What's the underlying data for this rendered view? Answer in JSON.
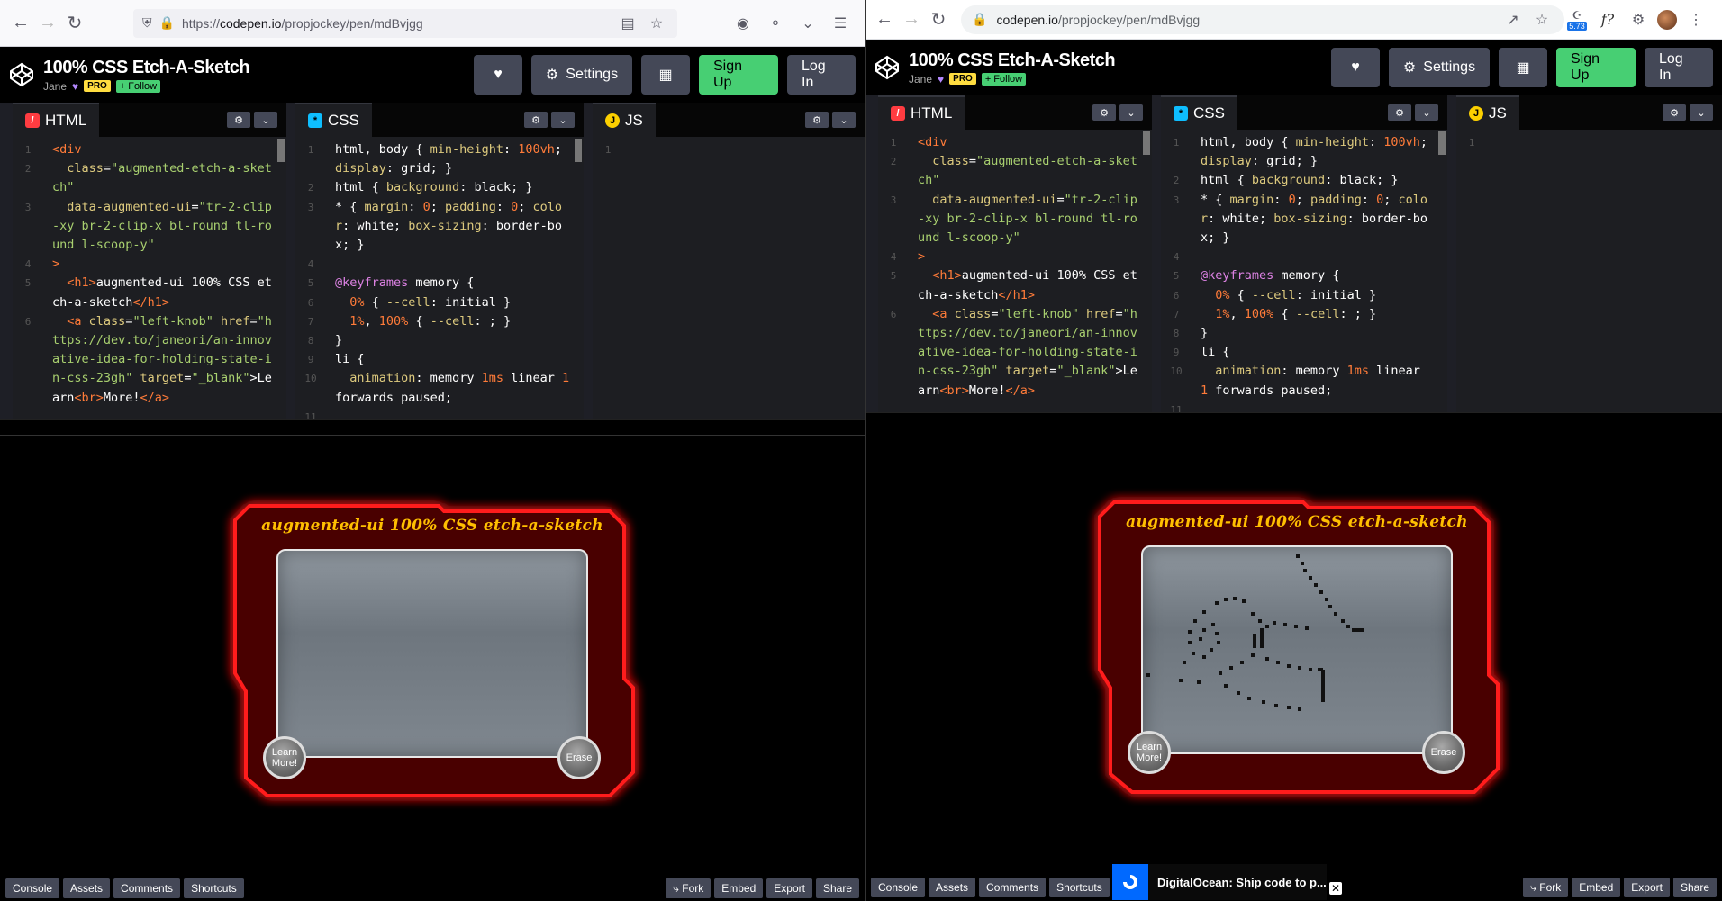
{
  "left": {
    "browser": "firefox",
    "url_prefix": "https://",
    "url_host": "codepen.io",
    "url_path": "/propjockey/pen/mdBvjgg"
  },
  "right": {
    "browser": "chrome",
    "url_host": "codepen.io",
    "url_path": "/propjockey/pen/mdBvjgg",
    "ext_badge": "5.73",
    "ext_f": "f?"
  },
  "pen": {
    "title": "100% CSS Etch-A-Sketch",
    "author": "Jane",
    "pro": "PRO",
    "follow": "+ Follow",
    "settings": "Settings",
    "signup": "Sign Up",
    "login": "Log In"
  },
  "editors": {
    "html": {
      "label": "HTML",
      "gutter": [
        "1",
        "2",
        "",
        "3",
        "",
        "",
        "4",
        "5",
        "",
        "6",
        "",
        "",
        "",
        "",
        "",
        ""
      ]
    },
    "css": {
      "label": "CSS",
      "gutter": [
        "1",
        "",
        "2",
        "3",
        "",
        "",
        "4",
        "5",
        "6",
        "7",
        "8",
        "9",
        "10",
        "",
        "11"
      ]
    },
    "js": {
      "label": "JS",
      "gutter": [
        "1"
      ]
    }
  },
  "etch": {
    "title": "augmented-ui 100% CSS etch-a-sketch",
    "learn": "Learn More!",
    "erase": "Erase"
  },
  "footer": {
    "console": "Console",
    "assets": "Assets",
    "comments": "Comments",
    "shortcuts": "Shortcuts",
    "fork": "Fork",
    "embed": "Embed",
    "export": "Export",
    "share": "Share"
  },
  "ad": {
    "text": "DigitalOcean: Ship code to p..."
  },
  "colors": {
    "signup": "#47cf73",
    "pro": "#ffdd40",
    "glow": "#ff0000",
    "title": "#ffbf00"
  }
}
